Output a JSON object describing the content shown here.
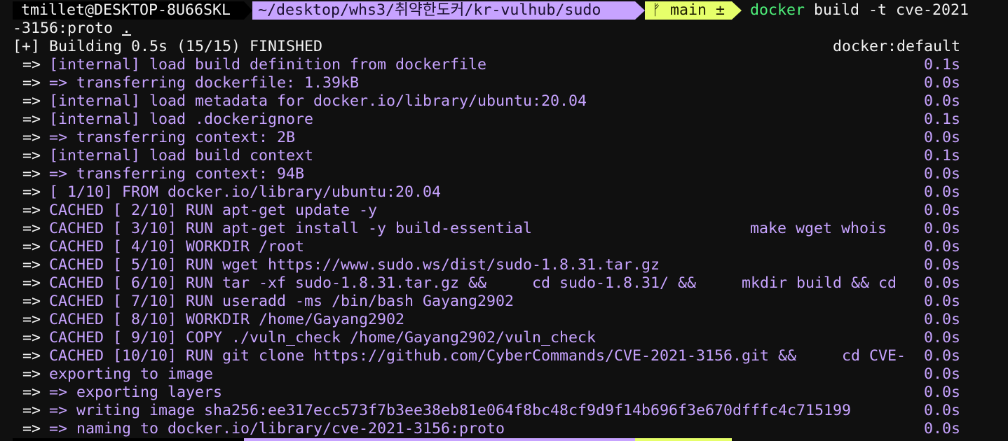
{
  "prompt": {
    "user_host": "tmillet@DESKTOP-8U66SKL",
    "directory": "~/desktop/whs3/취약한도커/kr-vulhub/sudo",
    "git_branch": "ᚠ main ±",
    "command_name": "docker",
    "command_args": "build -t cve-2021",
    "command_continuation": "-3156:proto",
    "command_dot": "."
  },
  "build_header": {
    "status": "[+] Building 0.5s (15/15) FINISHED",
    "context": "docker:default"
  },
  "colors": {
    "background": "#101010",
    "accent_purple": "#c7a3ff",
    "accent_yellow": "#e6ff6a",
    "accent_green": "#4ef07a",
    "text_white": "#f2f2f2"
  },
  "steps": [
    {
      "arrow": "=>",
      "text": "[internal] load build definition from dockerfile",
      "extra": "",
      "time": "0.1s"
    },
    {
      "arrow": "=>",
      "text": "=> transferring dockerfile: 1.39kB",
      "extra": "",
      "time": "0.0s"
    },
    {
      "arrow": "=>",
      "text": "[internal] load metadata for docker.io/library/ubuntu:20.04",
      "extra": "",
      "time": "0.0s"
    },
    {
      "arrow": "=>",
      "text": "[internal] load .dockerignore",
      "extra": "",
      "time": "0.1s"
    },
    {
      "arrow": "=>",
      "text": "=> transferring context: 2B",
      "extra": "",
      "time": "0.0s"
    },
    {
      "arrow": "=>",
      "text": "[internal] load build context",
      "extra": "",
      "time": "0.1s"
    },
    {
      "arrow": "=>",
      "text": "=> transferring context: 94B",
      "extra": "",
      "time": "0.0s"
    },
    {
      "arrow": "=>",
      "text": "[ 1/10] FROM docker.io/library/ubuntu:20.04",
      "extra": "",
      "time": "0.0s"
    },
    {
      "arrow": "=>",
      "text": "CACHED [ 2/10] RUN apt-get update -y",
      "extra": "",
      "time": "0.0s"
    },
    {
      "arrow": "=>",
      "text": "CACHED [ 3/10] RUN apt-get install -y build-essential",
      "extra": "make wget whois",
      "time": "0.0s"
    },
    {
      "arrow": "=>",
      "text": "CACHED [ 4/10] WORKDIR /root",
      "extra": "",
      "time": "0.0s"
    },
    {
      "arrow": "=>",
      "text": "CACHED [ 5/10] RUN wget https://www.sudo.ws/dist/sudo-1.8.31.tar.gz",
      "extra": "",
      "time": "0.0s"
    },
    {
      "arrow": "=>",
      "text": "CACHED [ 6/10] RUN tar -xf sudo-1.8.31.tar.gz &&     cd sudo-1.8.31/ &&     mkdir build && cd",
      "extra": "",
      "time": "0.0s"
    },
    {
      "arrow": "=>",
      "text": "CACHED [ 7/10] RUN useradd -ms /bin/bash Gayang2902",
      "extra": "",
      "time": "0.0s"
    },
    {
      "arrow": "=>",
      "text": "CACHED [ 8/10] WORKDIR /home/Gayang2902",
      "extra": "",
      "time": "0.0s"
    },
    {
      "arrow": "=>",
      "text": "CACHED [ 9/10] COPY ./vuln_check /home/Gayang2902/vuln_check",
      "extra": "",
      "time": "0.0s"
    },
    {
      "arrow": "=>",
      "text": "CACHED [10/10] RUN git clone https://github.com/CyberCommands/CVE-2021-3156.git &&     cd CVE-",
      "extra": "",
      "time": "0.0s"
    },
    {
      "arrow": "=>",
      "text": "exporting to image",
      "extra": "",
      "time": "0.0s"
    },
    {
      "arrow": "=>",
      "text": "=> exporting layers",
      "extra": "",
      "time": "0.0s"
    },
    {
      "arrow": "=>",
      "text": "=> writing image sha256:ee317ecc573f7b3ee38eb81e064f8bc48cf9d9f14b696f3e670dfffc4c715199",
      "extra": "",
      "time": "0.0s"
    },
    {
      "arrow": "=>",
      "text": "=> naming to docker.io/library/cve-2021-3156:proto",
      "extra": "",
      "time": "0.0s"
    }
  ]
}
